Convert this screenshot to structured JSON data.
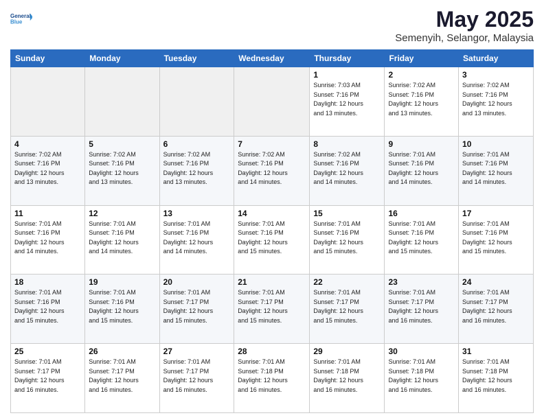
{
  "logo": {
    "line1": "General",
    "line2": "Blue"
  },
  "title": "May 2025",
  "subtitle": "Semenyih, Selangor, Malaysia",
  "days_header": [
    "Sunday",
    "Monday",
    "Tuesday",
    "Wednesday",
    "Thursday",
    "Friday",
    "Saturday"
  ],
  "weeks": [
    [
      {
        "day": "",
        "info": ""
      },
      {
        "day": "",
        "info": ""
      },
      {
        "day": "",
        "info": ""
      },
      {
        "day": "",
        "info": ""
      },
      {
        "day": "1",
        "info": "Sunrise: 7:03 AM\nSunset: 7:16 PM\nDaylight: 12 hours\nand 13 minutes."
      },
      {
        "day": "2",
        "info": "Sunrise: 7:02 AM\nSunset: 7:16 PM\nDaylight: 12 hours\nand 13 minutes."
      },
      {
        "day": "3",
        "info": "Sunrise: 7:02 AM\nSunset: 7:16 PM\nDaylight: 12 hours\nand 13 minutes."
      }
    ],
    [
      {
        "day": "4",
        "info": "Sunrise: 7:02 AM\nSunset: 7:16 PM\nDaylight: 12 hours\nand 13 minutes."
      },
      {
        "day": "5",
        "info": "Sunrise: 7:02 AM\nSunset: 7:16 PM\nDaylight: 12 hours\nand 13 minutes."
      },
      {
        "day": "6",
        "info": "Sunrise: 7:02 AM\nSunset: 7:16 PM\nDaylight: 12 hours\nand 13 minutes."
      },
      {
        "day": "7",
        "info": "Sunrise: 7:02 AM\nSunset: 7:16 PM\nDaylight: 12 hours\nand 14 minutes."
      },
      {
        "day": "8",
        "info": "Sunrise: 7:02 AM\nSunset: 7:16 PM\nDaylight: 12 hours\nand 14 minutes."
      },
      {
        "day": "9",
        "info": "Sunrise: 7:01 AM\nSunset: 7:16 PM\nDaylight: 12 hours\nand 14 minutes."
      },
      {
        "day": "10",
        "info": "Sunrise: 7:01 AM\nSunset: 7:16 PM\nDaylight: 12 hours\nand 14 minutes."
      }
    ],
    [
      {
        "day": "11",
        "info": "Sunrise: 7:01 AM\nSunset: 7:16 PM\nDaylight: 12 hours\nand 14 minutes."
      },
      {
        "day": "12",
        "info": "Sunrise: 7:01 AM\nSunset: 7:16 PM\nDaylight: 12 hours\nand 14 minutes."
      },
      {
        "day": "13",
        "info": "Sunrise: 7:01 AM\nSunset: 7:16 PM\nDaylight: 12 hours\nand 14 minutes."
      },
      {
        "day": "14",
        "info": "Sunrise: 7:01 AM\nSunset: 7:16 PM\nDaylight: 12 hours\nand 15 minutes."
      },
      {
        "day": "15",
        "info": "Sunrise: 7:01 AM\nSunset: 7:16 PM\nDaylight: 12 hours\nand 15 minutes."
      },
      {
        "day": "16",
        "info": "Sunrise: 7:01 AM\nSunset: 7:16 PM\nDaylight: 12 hours\nand 15 minutes."
      },
      {
        "day": "17",
        "info": "Sunrise: 7:01 AM\nSunset: 7:16 PM\nDaylight: 12 hours\nand 15 minutes."
      }
    ],
    [
      {
        "day": "18",
        "info": "Sunrise: 7:01 AM\nSunset: 7:16 PM\nDaylight: 12 hours\nand 15 minutes."
      },
      {
        "day": "19",
        "info": "Sunrise: 7:01 AM\nSunset: 7:16 PM\nDaylight: 12 hours\nand 15 minutes."
      },
      {
        "day": "20",
        "info": "Sunrise: 7:01 AM\nSunset: 7:17 PM\nDaylight: 12 hours\nand 15 minutes."
      },
      {
        "day": "21",
        "info": "Sunrise: 7:01 AM\nSunset: 7:17 PM\nDaylight: 12 hours\nand 15 minutes."
      },
      {
        "day": "22",
        "info": "Sunrise: 7:01 AM\nSunset: 7:17 PM\nDaylight: 12 hours\nand 15 minutes."
      },
      {
        "day": "23",
        "info": "Sunrise: 7:01 AM\nSunset: 7:17 PM\nDaylight: 12 hours\nand 16 minutes."
      },
      {
        "day": "24",
        "info": "Sunrise: 7:01 AM\nSunset: 7:17 PM\nDaylight: 12 hours\nand 16 minutes."
      }
    ],
    [
      {
        "day": "25",
        "info": "Sunrise: 7:01 AM\nSunset: 7:17 PM\nDaylight: 12 hours\nand 16 minutes."
      },
      {
        "day": "26",
        "info": "Sunrise: 7:01 AM\nSunset: 7:17 PM\nDaylight: 12 hours\nand 16 minutes."
      },
      {
        "day": "27",
        "info": "Sunrise: 7:01 AM\nSunset: 7:17 PM\nDaylight: 12 hours\nand 16 minutes."
      },
      {
        "day": "28",
        "info": "Sunrise: 7:01 AM\nSunset: 7:18 PM\nDaylight: 12 hours\nand 16 minutes."
      },
      {
        "day": "29",
        "info": "Sunrise: 7:01 AM\nSunset: 7:18 PM\nDaylight: 12 hours\nand 16 minutes."
      },
      {
        "day": "30",
        "info": "Sunrise: 7:01 AM\nSunset: 7:18 PM\nDaylight: 12 hours\nand 16 minutes."
      },
      {
        "day": "31",
        "info": "Sunrise: 7:01 AM\nSunset: 7:18 PM\nDaylight: 12 hours\nand 16 minutes."
      }
    ]
  ]
}
